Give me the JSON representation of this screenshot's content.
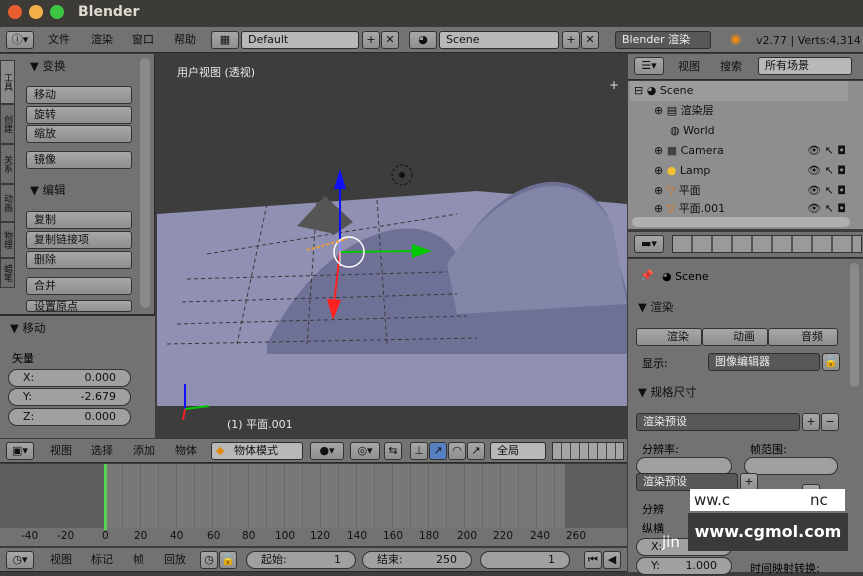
{
  "window": {
    "title": "Blender"
  },
  "info_bar": {
    "menus": [
      "文件",
      "渲染",
      "窗口",
      "帮助"
    ],
    "layout": "Default",
    "scene": "Scene",
    "engine": "Blender 渲染",
    "version": "v2.77 | Verts:4,314"
  },
  "tool_shelf": {
    "tabs": [
      "工具",
      "创建",
      "关系",
      "动画",
      "物理",
      "蜡笔"
    ],
    "transform": {
      "header": "▼ 变换",
      "buttons": [
        "移动",
        "旋转",
        "缩放",
        "镜像"
      ]
    },
    "edit": {
      "header": "▼ 编辑",
      "buttons": [
        "复制",
        "复制链接项",
        "删除",
        "合并",
        "设置原点"
      ]
    }
  },
  "operator": {
    "header": "▼ 移动",
    "vector_label": "矢量",
    "x_label": "X:",
    "x": "0.000",
    "y_label": "Y:",
    "y": "-2.679",
    "z_label": "Z:",
    "z": "0.000"
  },
  "viewport": {
    "view_label": "用户视图 (透视)",
    "object_label": "(1) 平面.001"
  },
  "view3d_header": {
    "menus": [
      "视图",
      "选择",
      "添加",
      "物体"
    ],
    "mode": "物体模式",
    "pivot": "全局"
  },
  "outliner": {
    "menus": [
      "视图",
      "搜索"
    ],
    "filter": "所有场景",
    "rows": [
      "Scene",
      "渲染层",
      "World",
      "Camera",
      "Lamp",
      "平面",
      "平面.001"
    ]
  },
  "properties": {
    "scene": "Scene",
    "render_header": "▼ 渲染",
    "render_buttons": [
      "渲染",
      "动画",
      "音频"
    ],
    "display_label": "显示:",
    "display_value": "图像编辑器",
    "dims_header": "▼ 规格尺寸",
    "preset": "渲染预设",
    "preset2": "渲染预设",
    "resolution_label": "分辨率:",
    "frame_range_label": "帧范围:",
    "res_short": "分辨",
    "aspect_label": "纵横",
    "y_label": "Y:",
    "y_value": "1.000",
    "time_remap": "时间映射转换:",
    "x_label": "X:"
  },
  "timeline": {
    "ticks": [
      "-40",
      "-20",
      "0",
      "20",
      "40",
      "60",
      "80",
      "100",
      "120",
      "140",
      "160",
      "180",
      "200",
      "220",
      "240",
      "260"
    ]
  },
  "timeline_header": {
    "menus": [
      "视图",
      "标记",
      "帧",
      "回放"
    ],
    "start_label": "起始:",
    "start": "1",
    "end_label": "结束:",
    "end": "250",
    "current": "1"
  },
  "watermark": {
    "site": "www.cgmol.com",
    "partial": "ww.c",
    "suffix": "nc",
    "jin": "jin"
  },
  "colors": {
    "viewport_bg": "#3d3d3d",
    "plane": "#8f90b2",
    "axis_x": "#00c800",
    "axis_y": "#ff2020",
    "axis_z": "#1010ff",
    "selected": "#f0a030"
  }
}
